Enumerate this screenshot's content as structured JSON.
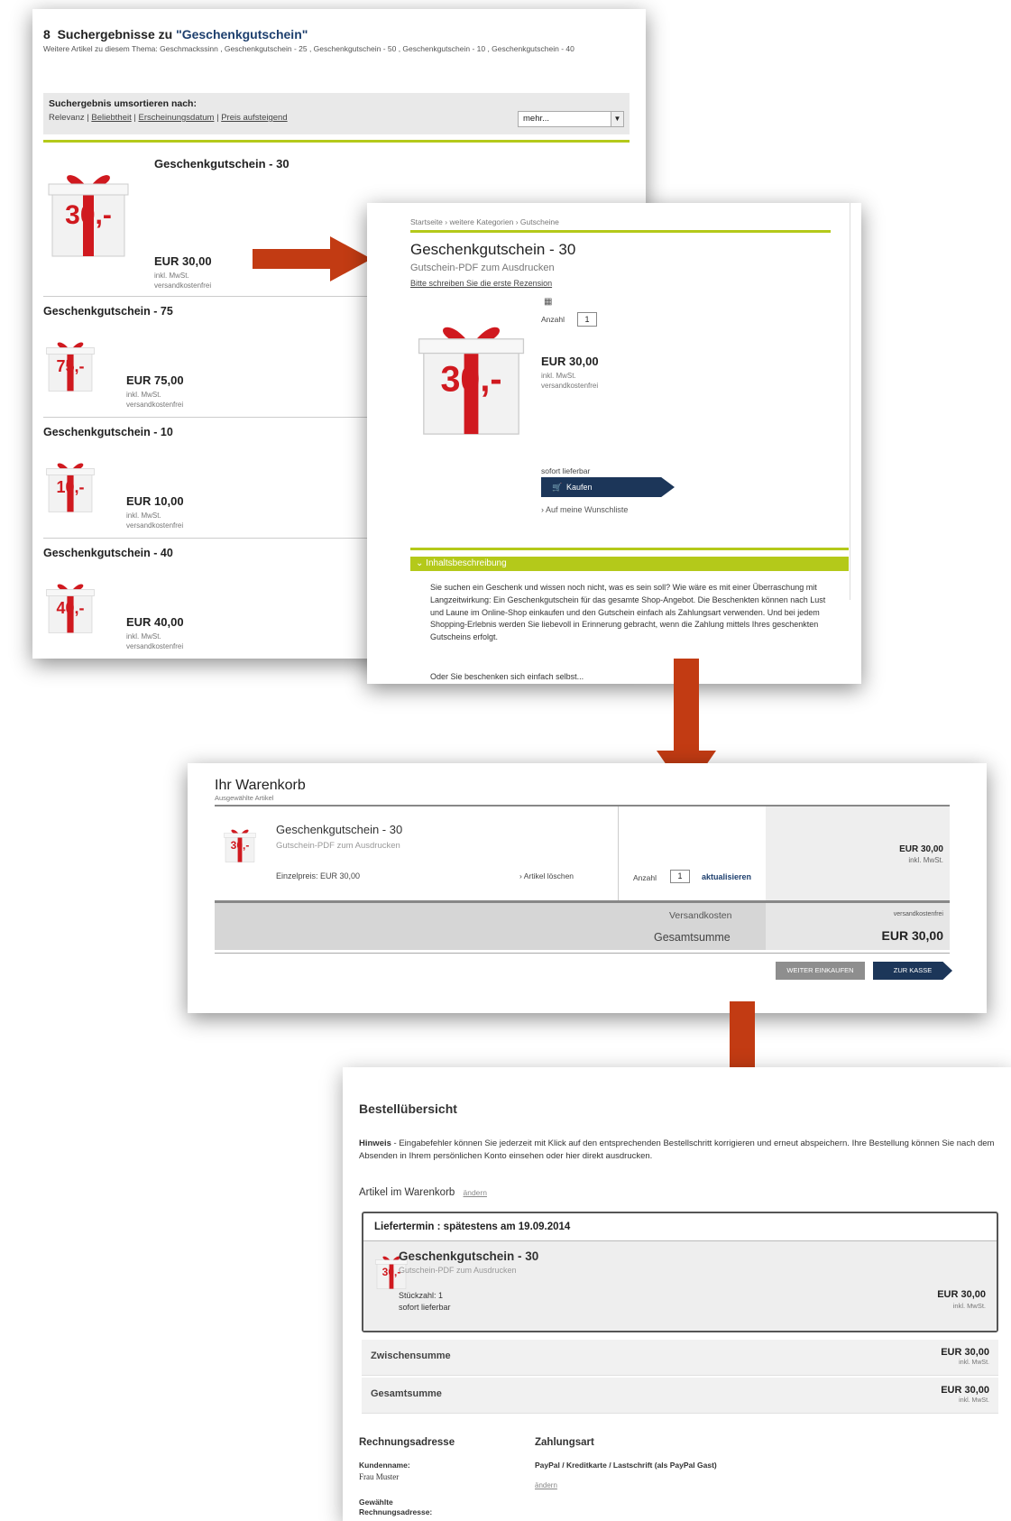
{
  "colors": {
    "accent_green": "#b4c91a",
    "navy": "#1c3659",
    "arrow_red": "#c23b13",
    "gift_red": "#d0191f"
  },
  "results": {
    "count": "8",
    "heading_prefix": "Suchergebnisse zu",
    "query": "\"Geschenkgutschein\"",
    "related": "Weitere Artikel zu diesem Thema: Geschmackssinn , Geschenkgutschein - 25 , Geschenkgutschein - 50 , Geschenkgutschein - 10 , Geschenkgutschein - 40",
    "sort_label": "Suchergebnis umsortieren nach:",
    "sort_options": [
      "Relevanz",
      "Beliebtheit",
      "Erscheinungsdatum",
      "Preis aufsteigend"
    ],
    "more_select": "mehr...",
    "vat": "inkl. MwSt.",
    "shipping": "versandkostenfrei",
    "items": [
      {
        "title": "Geschenkgutschein - 30",
        "price": "EUR 30,00",
        "badge": "30,-"
      },
      {
        "title": "Geschenkgutschein - 75",
        "price": "EUR 75,00",
        "badge": "75,-"
      },
      {
        "title": "Geschenkgutschein - 10",
        "price": "EUR 10,00",
        "badge": "10,-"
      },
      {
        "title": "Geschenkgutschein - 40",
        "price": "EUR 40,00",
        "badge": "40,-"
      }
    ]
  },
  "product": {
    "breadcrumb": "Startseite  ›  weitere Kategorien  ›  Gutscheine",
    "title": "Geschenkgutschein - 30",
    "subtitle": "Gutschein-PDF zum Ausdrucken",
    "review_link": "Bitte schreiben Sie die erste Rezension",
    "qty_label": "Anzahl",
    "qty": "1",
    "price": "EUR 30,00",
    "vat": "inkl. MwSt.",
    "shipping": "versandkostenfrei",
    "availability": "sofort lieferbar",
    "buy_label": "Kaufen",
    "wishlist_label": "Auf meine Wunschliste",
    "desc_header": "Inhaltsbeschreibung",
    "description": "Sie suchen ein Geschenk und wissen noch nicht, was es sein soll? Wie wäre es mit einer Überraschung mit Langzeitwirkung: Ein Geschenkgutschein für das gesamte Shop-Angebot. Die Beschenkten können nach Lust und Laune im Online-Shop einkaufen und den Gutschein einfach als Zahlungsart verwenden. Und bei jedem Shopping-Erlebnis werden Sie liebevoll in Erinnerung gebracht, wenn die Zahlung mittels Ihres geschenkten Gutscheins erfolgt.",
    "description2": "Oder Sie beschenken sich einfach selbst..."
  },
  "cart": {
    "title": "Ihr Warenkorb",
    "subtitle": "Ausgewählte Artikel",
    "item_title": "Geschenkgutschein - 30",
    "item_sub": "Gutschein-PDF zum Ausdrucken",
    "unit_price": "Einzelpreis: EUR 30,00",
    "delete": "Artikel löschen",
    "qty_label": "Anzahl",
    "qty": "1",
    "update": "aktualisieren",
    "price": "EUR 30,00",
    "vat": "inkl. MwSt.",
    "shipping_label": "Versandkosten",
    "shipping_value": "versandkostenfrei",
    "total_label": "Gesamtsumme",
    "total_value": "EUR 30,00",
    "continue_btn": "WEITER EINKAUFEN",
    "checkout_btn": "ZUR KASSE"
  },
  "order": {
    "title": "Bestellübersicht",
    "hint_bold": "Hinweis",
    "hint_text": " - Eingabefehler können Sie jederzeit mit Klick auf den entsprechenden Bestellschritt korrigieren und erneut abspeichern. Ihre Bestellung können Sie nach dem Absenden in Ihrem persönlichen Konto einsehen oder hier direkt ausdrucken.",
    "cart_label": "Artikel im Warenkorb",
    "change": "ändern",
    "delivery": "Liefertermin : spätestens am 19.09.2014",
    "item_title": "Geschenkgutschein - 30",
    "item_sub": "Gutschein-PDF zum Ausdrucken",
    "qty_line": "Stückzahl: 1",
    "avail_line": "sofort lieferbar",
    "item_price": "EUR  30,00",
    "vat": "inkl. MwSt.",
    "subtotal_label": "Zwischensumme",
    "subtotal_value": "EUR  30,00",
    "total_label": "Gesamtsumme",
    "total_value": "EUR  30,00",
    "billing_title": "Rechnungsadresse",
    "customer_label": "Kundenname:",
    "customer_value": "Frau Muster",
    "chosen_label_1": "Gewählte",
    "chosen_label_2": "Rechnungsadresse:",
    "payment_title": "Zahlungsart",
    "payment_value": "PayPal / Kreditkarte / Lastschrift (als PayPal Gast)",
    "payment_change": "ändern"
  }
}
